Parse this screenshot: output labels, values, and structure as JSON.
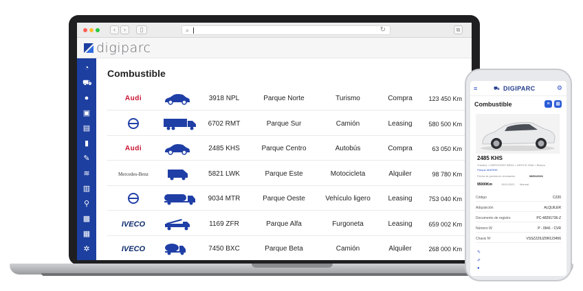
{
  "browser": {
    "url_text": ""
  },
  "app": {
    "logo_text": "digiparc",
    "brand_color": "#1c3fa0"
  },
  "sidebar": {
    "icons": [
      "dashboard-icon",
      "car-icon",
      "user-icon",
      "fuel-station-icon",
      "document-icon",
      "fuel-pump-icon",
      "wrench-icon",
      "layers-icon",
      "building-icon",
      "location-pin-icon",
      "vehicle-front-icon",
      "notes-icon",
      "gear-icon"
    ]
  },
  "page": {
    "title": "Combustible",
    "rows": [
      {
        "brand": "Audi",
        "vehicle_icon": "sedan-icon",
        "plate": "3918 NPL",
        "park": "Parque Norte",
        "type": "Turismo",
        "mode": "Compra",
        "km": "123 450 Km"
      },
      {
        "brand": "Volvo",
        "vehicle_icon": "truck-icon",
        "plate": "6702 RMT",
        "park": "Parque Sur",
        "type": "Camión",
        "mode": "Leasing",
        "km": "580 500 Km"
      },
      {
        "brand": "Audi",
        "vehicle_icon": "sedan-icon",
        "plate": "2485 KHS",
        "park": "Parque Centro",
        "type": "Autobús",
        "mode": "Compra",
        "km": "63 050 Km"
      },
      {
        "brand": "Mercedes-Benz",
        "vehicle_icon": "van-icon",
        "plate": "5821 LWK",
        "park": "Parque Este",
        "type": "Motocicleta",
        "mode": "Alquiler",
        "km": "98 780 Km"
      },
      {
        "brand": "Volvo",
        "vehicle_icon": "tanker-icon",
        "plate": "9034 MTR",
        "park": "Parque Oeste",
        "type": "Vehículo ligero",
        "mode": "Leasing",
        "km": "753 040 Km"
      },
      {
        "brand": "IVECO",
        "vehicle_icon": "crane-truck-icon",
        "plate": "1169 ZFR",
        "park": "Parque Alfa",
        "type": "Furgoneta",
        "mode": "Leasing",
        "km": "659 002 Km"
      },
      {
        "brand": "IVECO",
        "vehicle_icon": "mixer-truck-icon",
        "plate": "7450 BXC",
        "park": "Parque Beta",
        "type": "Camión",
        "mode": "Alquiler",
        "km": "268 000 Km"
      }
    ]
  },
  "phone": {
    "logo_text": "DIGIPARC",
    "title": "Combustible",
    "plate": "2485 KHS",
    "subtitle1": "Tracteur > MERCEDES BENZ > AROCS 3348 > Blanco",
    "subtitle2": "Parque MADRID",
    "date_label": "Fecha de puesta en circulación",
    "date_value": "08/01/2021",
    "km": "95000Km",
    "km_date": "15/11/2021",
    "km_mode": "Manual",
    "fields": [
      {
        "label": "Código",
        "value": "C220"
      },
      {
        "label": "Adquisición",
        "value": "ALQUILER"
      },
      {
        "label": "Documento de registro",
        "value": "PC-48291736-Z"
      },
      {
        "label": "Número W",
        "value": "P - 0941 - CVR"
      },
      {
        "label": "Chasis Nº",
        "value": "VSSZZZ6JZ9R123456"
      }
    ]
  }
}
